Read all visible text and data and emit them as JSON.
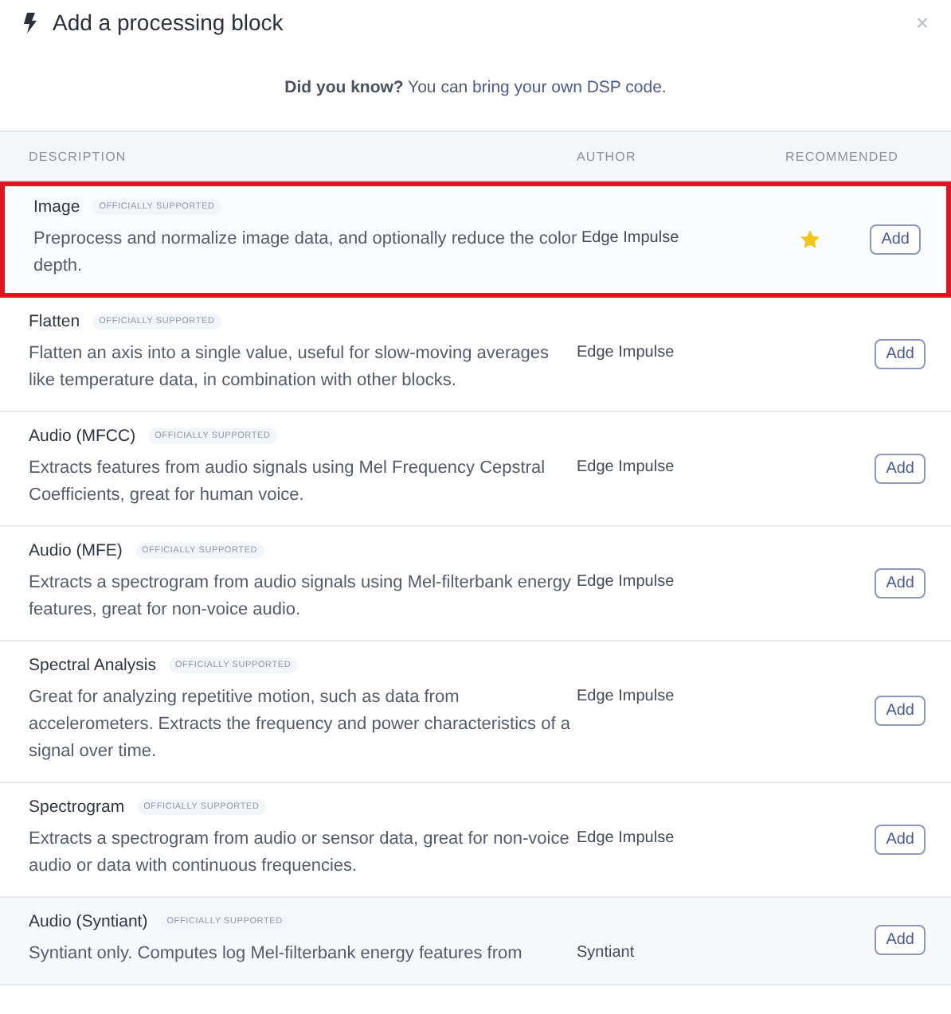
{
  "dialog": {
    "title": "Add a processing block",
    "close": "×"
  },
  "tip": {
    "lead": "Did you know?",
    "text": "You can",
    "link": "bring your own DSP code",
    "end": "."
  },
  "table": {
    "columns": [
      "DESCRIPTION",
      "AUTHOR",
      "RECOMMENDED"
    ],
    "rows": [
      {
        "name": "Image",
        "badge": "OFFICIALLY SUPPORTED",
        "description": "Preprocess and normalize image data, and optionally reduce the color depth.",
        "author": "Edge Impulse",
        "recommended": true,
        "highlighted": true,
        "button": "Add"
      },
      {
        "name": "Flatten",
        "badge": "OFFICIALLY SUPPORTED",
        "description": "Flatten an axis into a single value, useful for slow-moving averages like temperature data, in combination with other blocks.",
        "author": "Edge Impulse",
        "recommended": false,
        "highlighted": false,
        "button": "Add"
      },
      {
        "name": "Audio (MFCC)",
        "badge": "OFFICIALLY SUPPORTED",
        "description": "Extracts features from audio signals using Mel Frequency Cepstral Coefficients, great for human voice.",
        "author": "Edge Impulse",
        "recommended": false,
        "highlighted": false,
        "button": "Add"
      },
      {
        "name": "Audio (MFE)",
        "badge": "OFFICIALLY SUPPORTED",
        "description": "Extracts a spectrogram from audio signals using Mel-filterbank energy features, great for non-voice audio.",
        "author": "Edge Impulse",
        "recommended": false,
        "highlighted": false,
        "button": "Add"
      },
      {
        "name": "Spectral Analysis",
        "badge": "OFFICIALLY SUPPORTED",
        "description": "Great for analyzing repetitive motion, such as data from accelerometers. Extracts the frequency and power characteristics of a signal over time.",
        "author": "Edge Impulse",
        "recommended": false,
        "highlighted": false,
        "button": "Add"
      },
      {
        "name": "Spectrogram",
        "badge": "OFFICIALLY SUPPORTED",
        "description": "Extracts a spectrogram from audio or sensor data, great for non-voice audio or data with continuous frequencies.",
        "author": "Edge Impulse",
        "recommended": false,
        "highlighted": false,
        "button": "Add"
      },
      {
        "name": "Audio (Syntiant)",
        "badge": "OFFICIALLY SUPPORTED",
        "description": "Syntiant only. Computes log Mel-filterbank energy features from",
        "author": "Syntiant",
        "recommended": false,
        "highlighted": false,
        "button": "Add"
      }
    ]
  }
}
